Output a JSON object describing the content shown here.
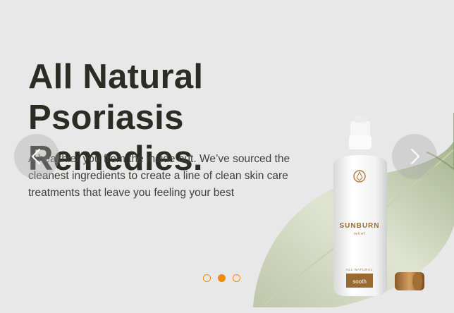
{
  "slide": {
    "headline_line1": "All Natural Psoriasis",
    "headline_line2": "Remedies.",
    "body": "A healthier you from the inside out. We’ve sourced the cleanest ingredients to create a line of clean skin care treatments that leave you feeling your best"
  },
  "product": {
    "name": "SUNBURN",
    "subname": "relief",
    "tag": "ALL NATURAL",
    "brand": "sooth"
  },
  "navigation": {
    "prev_icon": "chevron-left-icon",
    "next_icon": "chevron-right-icon",
    "total_slides": 3,
    "active_slide": 2
  },
  "colors": {
    "accent": "#f08c00",
    "headline": "#2b2c24",
    "background": "#e8e8e8"
  }
}
